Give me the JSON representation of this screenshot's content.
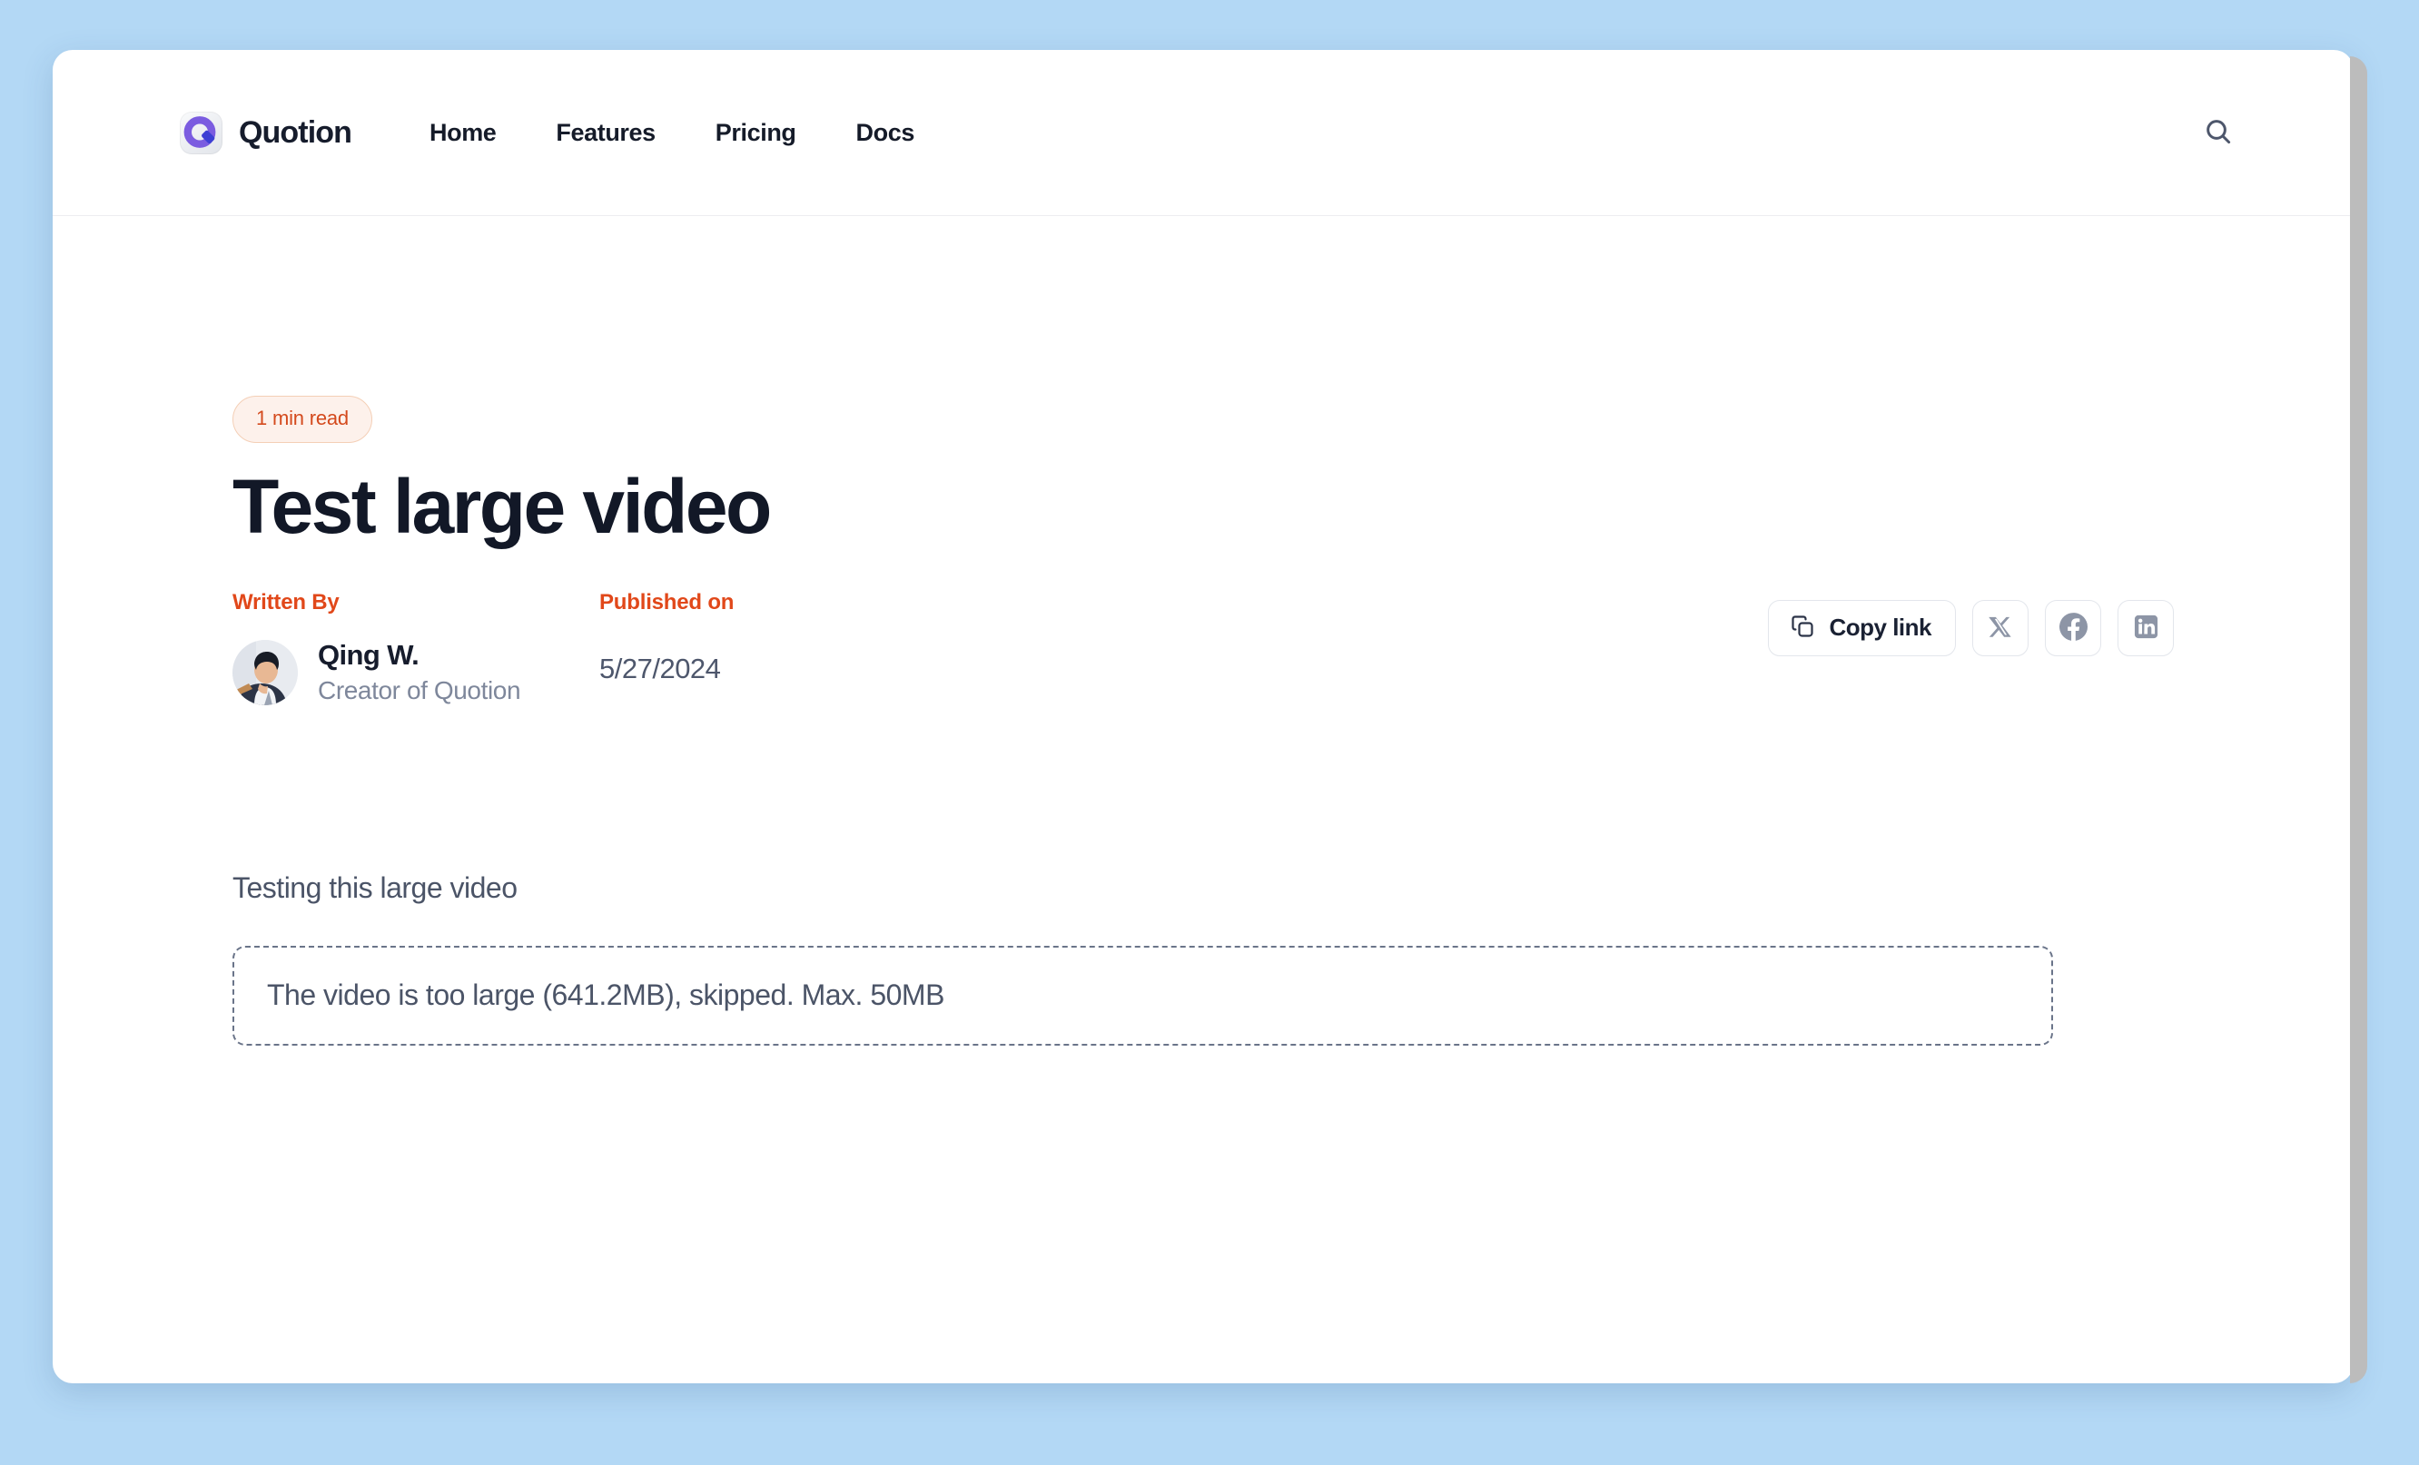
{
  "theme": {
    "page_background": "#b3d8f5",
    "accent_orange": "#e1481a",
    "badge_text": "#d44a1d",
    "badge_background": "#fdf1eb",
    "title_color": "#121827",
    "body_text": "#4b5467",
    "muted_text": "#7e879b",
    "logo_purple": "#7b5ce0",
    "logo_indigo": "#3d3fd4",
    "social_icon_gray": "#8d95a6"
  },
  "header": {
    "brand_name": "Quotion",
    "logo_icon": "quotion-logo-icon",
    "nav": [
      {
        "label": "Home"
      },
      {
        "label": "Features"
      },
      {
        "label": "Pricing"
      },
      {
        "label": "Docs"
      }
    ],
    "search_icon": "search-icon"
  },
  "article": {
    "read_badge": "1 min read",
    "title": "Test large video",
    "written_by_label": "Written By",
    "published_on_label": "Published on",
    "author": {
      "name": "Qing W.",
      "role": "Creator of Quotion",
      "avatar_icon": "author-avatar"
    },
    "published_date": "5/27/2024",
    "body_paragraph": "Testing this large video",
    "video_placeholder_message": "The video is too large (641.2MB), skipped. Max. 50MB"
  },
  "share": {
    "copy_link_label": "Copy link",
    "copy_icon": "copy-icon",
    "buttons": [
      {
        "name": "x-twitter",
        "icon": "x-twitter-icon"
      },
      {
        "name": "facebook",
        "icon": "facebook-icon"
      },
      {
        "name": "linkedin",
        "icon": "linkedin-icon"
      }
    ]
  }
}
